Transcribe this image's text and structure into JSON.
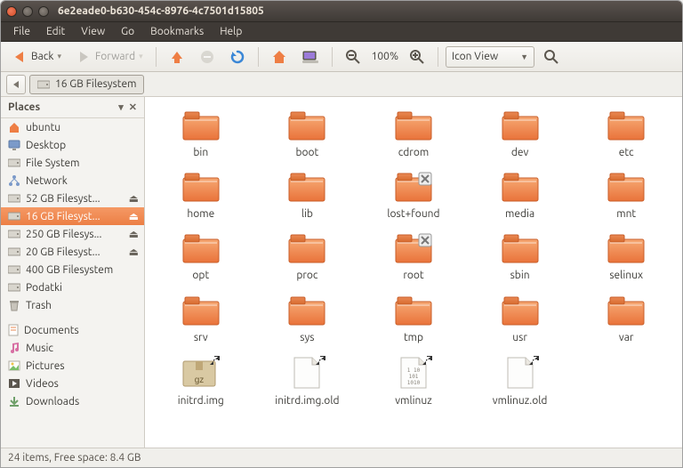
{
  "window": {
    "title": "6e2eade0-b630-454c-8976-4c7501d15805"
  },
  "menu": {
    "items": [
      "File",
      "Edit",
      "View",
      "Go",
      "Bookmarks",
      "Help"
    ]
  },
  "toolbar": {
    "back_label": "Back",
    "forward_label": "Forward",
    "zoom_label": "100%",
    "view_mode_label": "Icon View"
  },
  "pathbar": {
    "segment_label": "16 GB Filesystem"
  },
  "sidebar": {
    "header": "Places",
    "items": [
      {
        "label": "ubuntu",
        "icon": "home",
        "ejectable": false,
        "selected": false
      },
      {
        "label": "Desktop",
        "icon": "desktop",
        "ejectable": false,
        "selected": false
      },
      {
        "label": "File System",
        "icon": "drive",
        "ejectable": false,
        "selected": false
      },
      {
        "label": "Network",
        "icon": "network",
        "ejectable": false,
        "selected": false
      },
      {
        "label": "52 GB Filesyst...",
        "icon": "drive",
        "ejectable": true,
        "selected": false
      },
      {
        "label": "16 GB Filesyst...",
        "icon": "drive",
        "ejectable": true,
        "selected": true
      },
      {
        "label": "250 GB Filesys...",
        "icon": "drive",
        "ejectable": true,
        "selected": false
      },
      {
        "label": "20 GB Filesyst...",
        "icon": "drive",
        "ejectable": true,
        "selected": false
      },
      {
        "label": "400 GB Filesystem",
        "icon": "drive",
        "ejectable": false,
        "selected": false
      },
      {
        "label": "Podatki",
        "icon": "drive",
        "ejectable": false,
        "selected": false
      },
      {
        "label": "Trash",
        "icon": "trash",
        "ejectable": false,
        "selected": false
      },
      {
        "label": "Documents",
        "icon": "doc",
        "ejectable": false,
        "selected": false,
        "gap": true
      },
      {
        "label": "Music",
        "icon": "music",
        "ejectable": false,
        "selected": false
      },
      {
        "label": "Pictures",
        "icon": "pic",
        "ejectable": false,
        "selected": false
      },
      {
        "label": "Videos",
        "icon": "video",
        "ejectable": false,
        "selected": false
      },
      {
        "label": "Downloads",
        "icon": "down",
        "ejectable": false,
        "selected": false
      }
    ]
  },
  "files": [
    {
      "name": "bin",
      "type": "folder"
    },
    {
      "name": "boot",
      "type": "folder"
    },
    {
      "name": "cdrom",
      "type": "folder"
    },
    {
      "name": "dev",
      "type": "folder"
    },
    {
      "name": "etc",
      "type": "folder"
    },
    {
      "name": "home",
      "type": "folder"
    },
    {
      "name": "lib",
      "type": "folder"
    },
    {
      "name": "lost+found",
      "type": "folder-locked"
    },
    {
      "name": "media",
      "type": "folder"
    },
    {
      "name": "mnt",
      "type": "folder"
    },
    {
      "name": "opt",
      "type": "folder"
    },
    {
      "name": "proc",
      "type": "folder"
    },
    {
      "name": "root",
      "type": "folder-locked"
    },
    {
      "name": "sbin",
      "type": "folder"
    },
    {
      "name": "selinux",
      "type": "folder"
    },
    {
      "name": "srv",
      "type": "folder"
    },
    {
      "name": "sys",
      "type": "folder"
    },
    {
      "name": "tmp",
      "type": "folder"
    },
    {
      "name": "usr",
      "type": "folder"
    },
    {
      "name": "var",
      "type": "folder"
    },
    {
      "name": "initrd.img",
      "type": "gz-link"
    },
    {
      "name": "initrd.img.old",
      "type": "file-link"
    },
    {
      "name": "vmlinuz",
      "type": "bin-link"
    },
    {
      "name": "vmlinuz.old",
      "type": "file-link"
    }
  ],
  "status": {
    "text": "24 items, Free space: 8.4 GB"
  },
  "colors": {
    "accent": "#ee7e44",
    "folder": "#f28d4f",
    "folder_dark": "#d66a2e"
  }
}
